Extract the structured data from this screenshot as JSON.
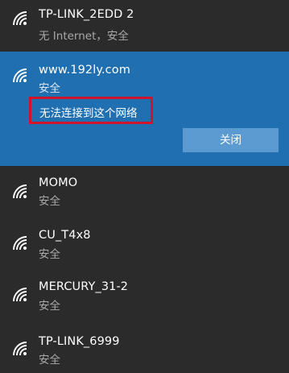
{
  "networks": [
    {
      "ssid": "TP-LINK_2EDD 2",
      "status": "无 Internet，安全",
      "icon": "wifi-signal-icon"
    },
    {
      "ssid": "www.192ly.com",
      "status": "安全",
      "icon": "wifi-signal-icon",
      "expanded": true,
      "error_message": "无法连接到这个网络",
      "close_label": "关闭"
    },
    {
      "ssid": "MOMO",
      "status": "安全",
      "icon": "wifi-signal-icon"
    },
    {
      "ssid": "CU_T4x8",
      "status": "安全",
      "icon": "wifi-signal-icon"
    },
    {
      "ssid": "MERCURY_31-2",
      "status": "安全",
      "icon": "wifi-signal-icon"
    },
    {
      "ssid": "TP-LINK_6999",
      "status": "安全",
      "icon": "wifi-signal-icon"
    }
  ],
  "colors": {
    "background": "#2b2b2b",
    "selected_background": "#1f6fb1",
    "button_background": "#5c9bd1",
    "error_highlight": "#d0142c",
    "secondary_text": "#a9a9a9"
  }
}
